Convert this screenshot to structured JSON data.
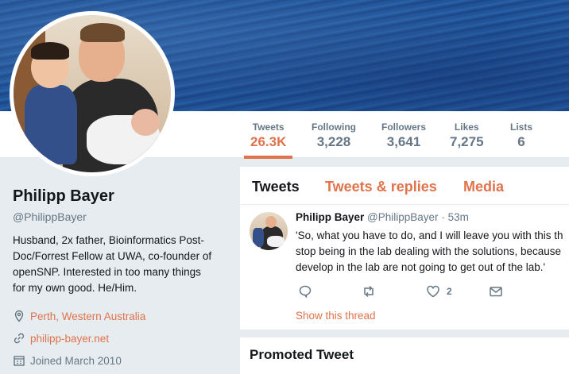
{
  "colors": {
    "accent": "#e0734b",
    "muted": "#657786",
    "text": "#14171a",
    "background": "#e6ecf0"
  },
  "stats": [
    {
      "label": "Tweets",
      "value": "26.3K",
      "active": true
    },
    {
      "label": "Following",
      "value": "3,228"
    },
    {
      "label": "Followers",
      "value": "3,641"
    },
    {
      "label": "Likes",
      "value": "7,275"
    },
    {
      "label": "Lists",
      "value": "6"
    }
  ],
  "profile": {
    "name": "Philipp Bayer",
    "handle": "@PhilippBayer",
    "bio_lines": [
      "Husband, 2x father, Bioinformatics Post-",
      "Doc/Forrest Fellow at UWA, co-founder of",
      "openSNP. Interested in too many things",
      "for my own good. He/Him."
    ],
    "location": "Perth, Western Australia",
    "website": "philipp-bayer.net",
    "joined": "Joined March 2010",
    "icons": {
      "location": "location-pin-icon",
      "website": "link-icon",
      "joined": "calendar-icon"
    }
  },
  "tabs": {
    "tweets": "Tweets",
    "replies": "Tweets & replies",
    "media": "Media"
  },
  "tweet": {
    "name": "Philipp Bayer",
    "handle": "@PhilippBayer",
    "separator": "·",
    "time": "53m",
    "lines": [
      "'So, what you have to do, and I will leave you with this th",
      "stop being in the lab dealing with the solutions, because",
      "develop in the lab are not going to get out of the lab.'"
    ],
    "actions": {
      "reply_icon": "reply-icon",
      "retweet_icon": "retweet-icon",
      "like_icon": "heart-icon",
      "like_count": "2",
      "message_icon": "envelope-icon"
    },
    "show_thread": "Show this thread"
  },
  "promoted": {
    "title": "Promoted Tweet"
  }
}
